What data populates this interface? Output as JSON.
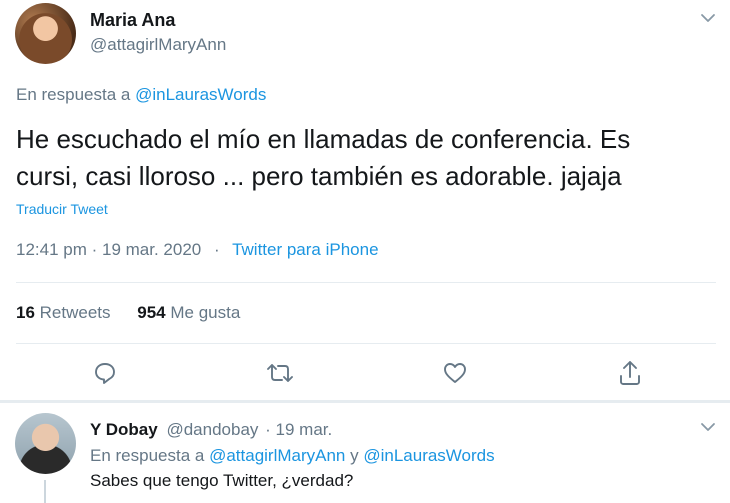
{
  "tweet": {
    "author_name": "Maria Ana",
    "author_handle": "@attagirlMaryAnn",
    "reply_prefix": "En respuesta a ",
    "reply_to": "@inLaurasWords",
    "text_line1": "He escuchado el mío en llamadas de conferencia. Es",
    "text_line2": "cursi, casi lloroso ... pero también es adorable. jajaja",
    "translate_label": "Traducir Tweet",
    "timestamp": "12:41 pm · 19 mar. 2020",
    "separator": "·",
    "source": "Twitter para iPhone",
    "retweets_count": "16",
    "retweets_label": "Retweets",
    "likes_count": "954",
    "likes_label": "Me gusta"
  },
  "reply": {
    "author_name": "Y Dobay",
    "author_handle": "@dandobay",
    "date": "· 19 mar.",
    "reply_prefix": "En respuesta a ",
    "reply_to_1": "@attagirlMaryAnn",
    "reply_joiner": " y ",
    "reply_to_2": "@inLaurasWords",
    "text": "Sabes que tengo Twitter, ¿verdad?"
  },
  "icons": {
    "more": "chevron-down-icon",
    "reply": "reply-icon",
    "retweet": "retweet-icon",
    "like": "heart-icon",
    "share": "share-icon"
  },
  "colors": {
    "link": "#1b95e0",
    "muted": "#657786",
    "text": "#14171a",
    "divider": "#e6ecf0"
  }
}
